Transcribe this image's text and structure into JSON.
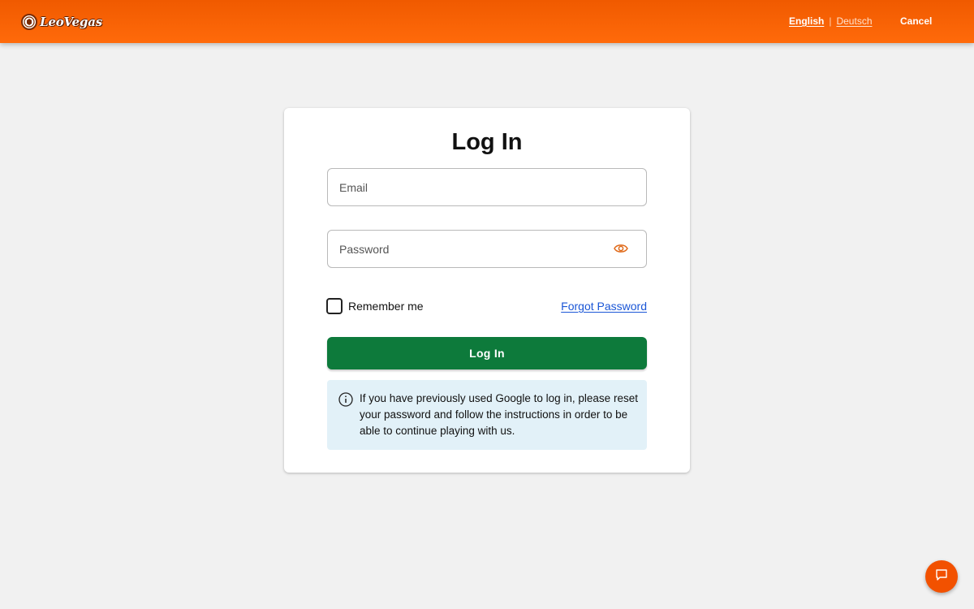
{
  "header": {
    "logo_text": "LeoVegas",
    "languages": [
      {
        "label": "English",
        "active": true
      },
      {
        "label": "Deutsch",
        "active": false
      }
    ],
    "separator": "|",
    "cancel_label": "Cancel"
  },
  "login": {
    "title": "Log In",
    "email_placeholder": "Email",
    "password_placeholder": "Password",
    "remember_label": "Remember me",
    "remember_checked": false,
    "forgot_label": "Forgot Password",
    "submit_label": "Log In",
    "info_text": "If you have previously used Google to log in, please reset your password and follow the instructions in order to be able to continue playing with us."
  },
  "icons": {
    "logo": "lion-icon",
    "password_toggle": "eye-icon",
    "info": "info-icon",
    "chat": "chat-bubble-icon"
  },
  "colors": {
    "header_orange": "#f05a00",
    "primary_green": "#0d7a3b",
    "link_blue": "#1a56d6",
    "info_bg": "#e2f1f8",
    "chat_orange": "#f25100",
    "eye_orange": "#e06a1a"
  }
}
